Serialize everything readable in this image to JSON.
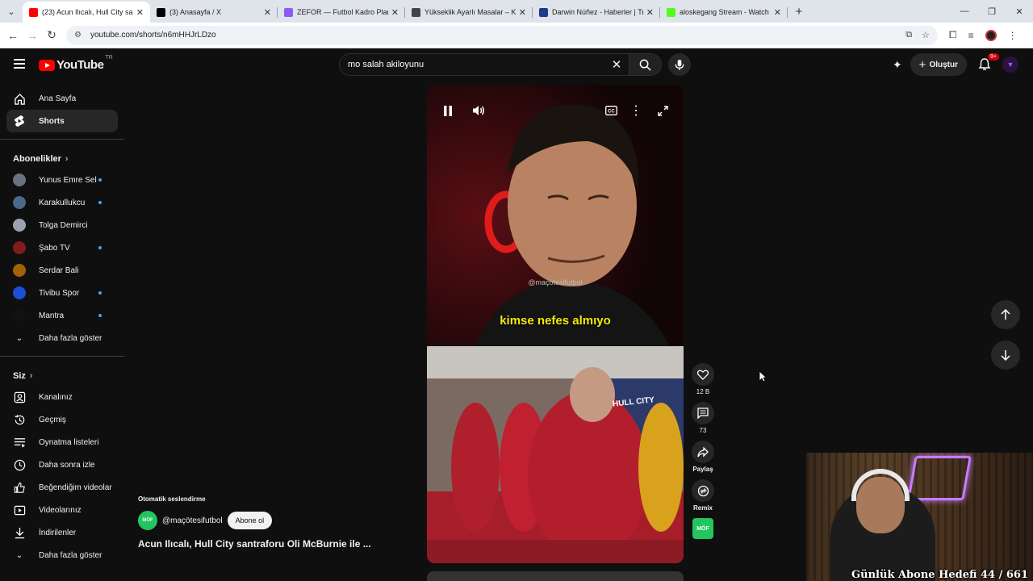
{
  "browser": {
    "tabs": [
      {
        "title": "(23) Acun Ilıcalı, Hull City sa",
        "active": true,
        "favicon_color": "#ff0000"
      },
      {
        "title": "(3) Anasayfa / X",
        "active": false,
        "favicon_color": "#000000"
      },
      {
        "title": "ZEFOR — Futbol Kadro Planlam",
        "active": false,
        "favicon_color": "#8b5cf6"
      },
      {
        "title": "Yükseklik Ayarlı Masalar – Karn",
        "active": false,
        "favicon_color": "#444444"
      },
      {
        "title": "Darwin Núñez - Haberler | Trans",
        "active": false,
        "favicon_color": "#1e3a8a"
      },
      {
        "title": "aloskegang Stream - Watch Live",
        "active": false,
        "favicon_color": "#53fc18"
      }
    ],
    "url": "youtube.com/shorts/n6mHHJrLDzo"
  },
  "header": {
    "logo_text": "YouTube",
    "country_code": "TR",
    "search_query": "mo salah akiloyunu",
    "create_label": "Oluştur",
    "notif_badge": "9+"
  },
  "sidebar": {
    "main": [
      {
        "label": "Ana Sayfa",
        "icon": "home-icon"
      },
      {
        "label": "Shorts",
        "icon": "shorts-icon",
        "active": true
      }
    ],
    "subs_heading": "Abonelikler",
    "subscriptions": [
      {
        "label": "Yunus Emre Sel",
        "color": "#6b7280",
        "dot": true
      },
      {
        "label": "Karakullukcu",
        "color": "#4b6a8a",
        "dot": true
      },
      {
        "label": "Tolga Demirci",
        "color": "#9ca3af",
        "dot": false
      },
      {
        "label": "Şabo TV",
        "color": "#7f1d1d",
        "dot": true
      },
      {
        "label": "Serdar Bali",
        "color": "#a16207",
        "dot": false
      },
      {
        "label": "Tivibu Spor",
        "color": "#1d4ed8",
        "dot": true
      },
      {
        "label": "Mantra",
        "color": "#111111",
        "dot": true
      }
    ],
    "show_more": "Daha fazla göster",
    "you_heading": "Siz",
    "you_items": [
      {
        "label": "Kanalınız",
        "icon": "person-box-icon"
      },
      {
        "label": "Geçmiş",
        "icon": "history-icon"
      },
      {
        "label": "Oynatma listeleri",
        "icon": "playlist-icon"
      },
      {
        "label": "Daha sonra izle",
        "icon": "clock-icon"
      },
      {
        "label": "Beğendiğim videolar",
        "icon": "thumb-up-icon"
      },
      {
        "label": "Videolarınız",
        "icon": "video-icon"
      },
      {
        "label": "İndirilenler",
        "icon": "download-icon"
      }
    ],
    "show_more_2": "Daha fazla göster"
  },
  "video": {
    "caption": "kimse nefes almıyo",
    "watermark": "@maçötesifutbol",
    "jersey_text": "HULL CITY"
  },
  "actions": {
    "likes": "12 B",
    "comments": "73",
    "share": "Paylaş",
    "remix": "Remix",
    "sound_thumb": "MÖF"
  },
  "meta": {
    "auto_dub": "Otomatik seslendirme",
    "channel": "@maçötesifutbol",
    "channel_avatar": "MÖF",
    "subscribe": "Abone ol",
    "title": "Acun Ilıcalı, Hull City santraforu Oli McBurnie ile ..."
  },
  "overlay": {
    "goal_text": "Günlük Abone Hedefi 44 / 661"
  }
}
